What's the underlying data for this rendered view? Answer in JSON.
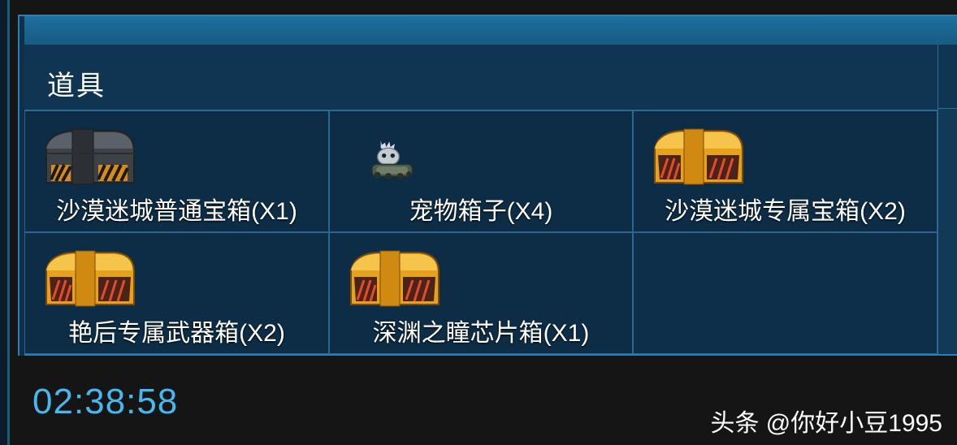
{
  "section": {
    "title": "道具"
  },
  "items": [
    {
      "label": "沙漠迷城普通宝箱(X1)",
      "icon": "gray-chest-icon"
    },
    {
      "label": "宠物箱子(X4)",
      "icon": "pet-tank-icon"
    },
    {
      "label": "沙漠迷城专属宝箱(X2)",
      "icon": "gold-chest-icon"
    },
    {
      "label": "艳后专属武器箱(X2)",
      "icon": "gold-chest-icon"
    },
    {
      "label": "深渊之瞳芯片箱(X1)",
      "icon": "gold-chest-icon"
    }
  ],
  "timer": {
    "value": "02:38:58"
  },
  "watermark": {
    "text": "头条 @你好小豆1995"
  },
  "colors": {
    "accent": "#47b8ee",
    "panel": "#0d2d46",
    "border": "#2a6790",
    "gold": "#e5a21a"
  }
}
